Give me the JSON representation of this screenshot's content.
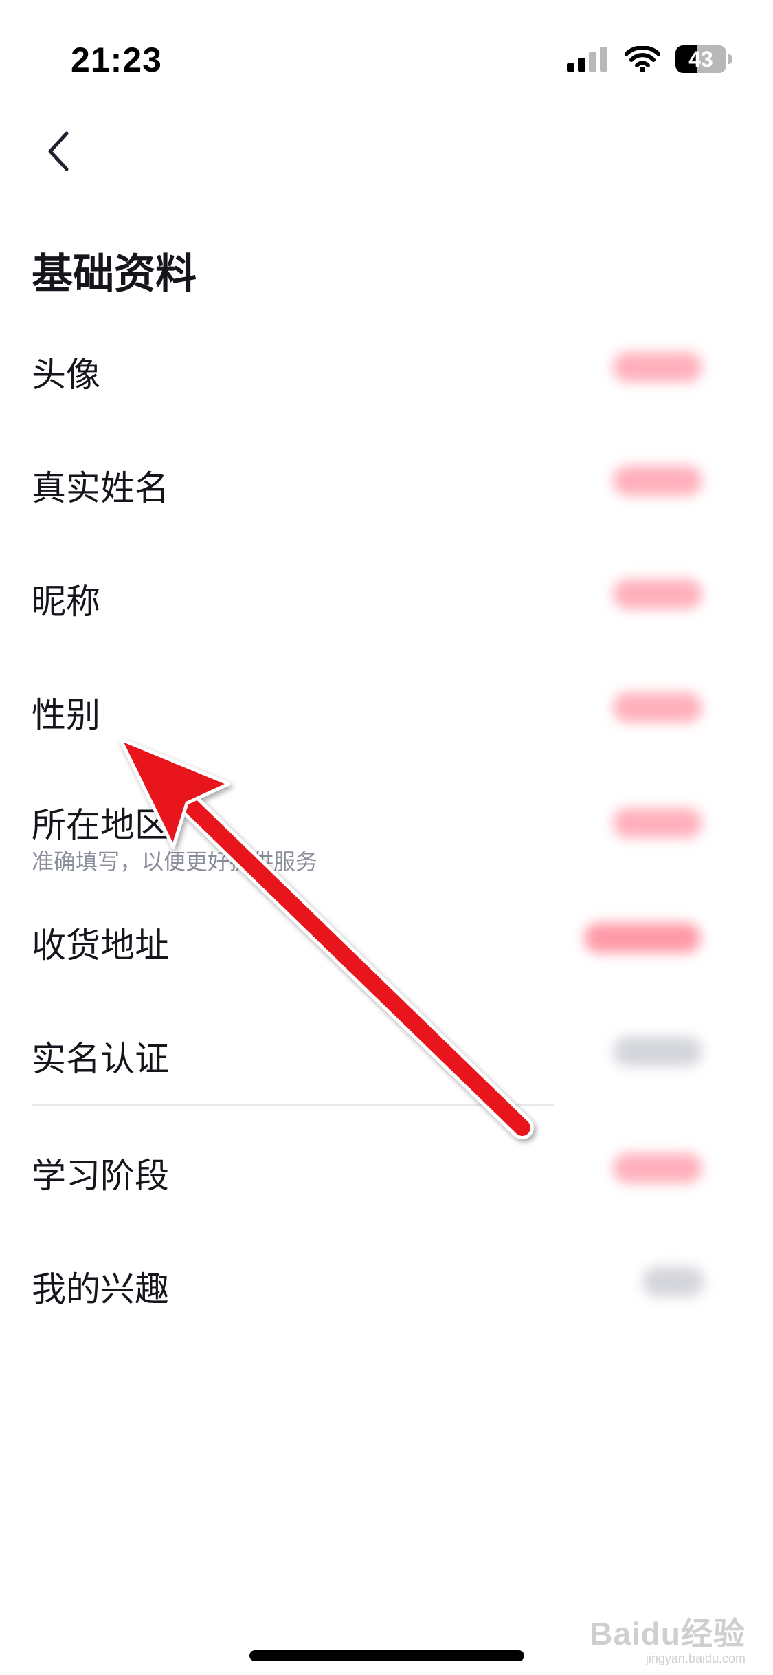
{
  "status_bar": {
    "time": "21:23",
    "battery_level": "43",
    "icons": [
      "cellular-signal-icon",
      "wifi-icon",
      "battery-icon"
    ]
  },
  "header": {
    "back_icon": "chevron-left-icon",
    "title": "基础资料"
  },
  "rows": [
    {
      "label": "头像",
      "sub": "",
      "value_state": "redacted"
    },
    {
      "label": "真实姓名",
      "sub": "",
      "value_state": "redacted"
    },
    {
      "label": "昵称",
      "sub": "",
      "value_state": "redacted"
    },
    {
      "label": "性别",
      "sub": "",
      "value_state": "redacted"
    },
    {
      "label": "所在地区",
      "sub": "准确填写，以便更好提供服务",
      "value_state": "redacted"
    },
    {
      "label": "收货地址",
      "sub": "",
      "value_state": "redacted"
    },
    {
      "label": "实名认证",
      "sub": "",
      "value_state": "redacted"
    },
    {
      "label": "学习阶段",
      "sub": "",
      "value_state": "redacted"
    },
    {
      "label": "我的兴趣",
      "sub": "",
      "value_state": "redacted"
    }
  ],
  "overlay": {
    "annotation": "red-arrow-pointing-to-gender",
    "arrow_color": "#e8141b"
  },
  "watermark": {
    "main": "Baidu经验",
    "sub": "jingyan.baidu.com"
  },
  "colors": {
    "text_primary": "#15161c",
    "text_secondary": "#8a8e9a",
    "redacted_value_pink": "#ff9aa8",
    "redacted_value_gray": "#d4d6dc"
  }
}
